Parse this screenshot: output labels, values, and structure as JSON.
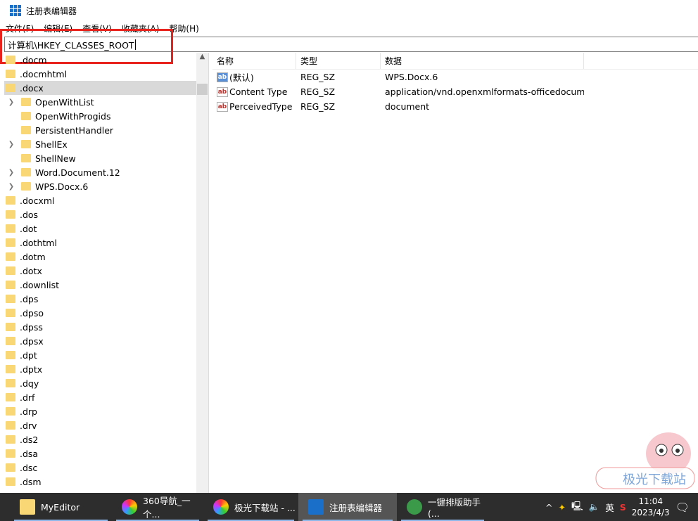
{
  "window": {
    "title": "注册表编辑器"
  },
  "menu": [
    "文件(F)",
    "编辑(E)",
    "查看(V)",
    "收藏夹(A)",
    "帮助(H)"
  ],
  "address": "计算机\\HKEY_CLASSES_ROOT",
  "tree": [
    {
      "label": ".docm",
      "level": 0
    },
    {
      "label": ".docmhtml",
      "level": 0
    },
    {
      "label": ".docx",
      "level": 0,
      "selected": true
    },
    {
      "label": "OpenWithList",
      "level": 1,
      "expandable": true
    },
    {
      "label": "OpenWithProgids",
      "level": 1
    },
    {
      "label": "PersistentHandler",
      "level": 1
    },
    {
      "label": "ShellEx",
      "level": 1,
      "expandable": true
    },
    {
      "label": "ShellNew",
      "level": 1
    },
    {
      "label": "Word.Document.12",
      "level": 1,
      "expandable": true
    },
    {
      "label": "WPS.Docx.6",
      "level": 1,
      "expandable": true
    },
    {
      "label": ".docxml",
      "level": 0
    },
    {
      "label": ".dos",
      "level": 0
    },
    {
      "label": ".dot",
      "level": 0
    },
    {
      "label": ".dothtml",
      "level": 0
    },
    {
      "label": ".dotm",
      "level": 0
    },
    {
      "label": ".dotx",
      "level": 0
    },
    {
      "label": ".downlist",
      "level": 0
    },
    {
      "label": ".dps",
      "level": 0
    },
    {
      "label": ".dpso",
      "level": 0
    },
    {
      "label": ".dpss",
      "level": 0
    },
    {
      "label": ".dpsx",
      "level": 0
    },
    {
      "label": ".dpt",
      "level": 0
    },
    {
      "label": ".dptx",
      "level": 0
    },
    {
      "label": ".dqy",
      "level": 0
    },
    {
      "label": ".drf",
      "level": 0
    },
    {
      "label": ".drp",
      "level": 0
    },
    {
      "label": ".drv",
      "level": 0
    },
    {
      "label": ".ds2",
      "level": 0
    },
    {
      "label": ".dsa",
      "level": 0
    },
    {
      "label": ".dsc",
      "level": 0
    },
    {
      "label": ".dsm",
      "level": 0
    }
  ],
  "list": {
    "headers": [
      "名称",
      "类型",
      "数据"
    ],
    "rows": [
      {
        "name": "(默认)",
        "type": "REG_SZ",
        "data": "WPS.Docx.6",
        "default": true
      },
      {
        "name": "Content Type",
        "type": "REG_SZ",
        "data": "application/vnd.openxmlformats-officedocum..."
      },
      {
        "name": "PerceivedType",
        "type": "REG_SZ",
        "data": "document"
      }
    ]
  },
  "taskbar": {
    "items": [
      {
        "label": "MyEditor",
        "icon": "folder-icon",
        "color": "#f8d774"
      },
      {
        "label": "360导航_一个...",
        "icon": "360-browser-icon",
        "color": "#e84"
      },
      {
        "label": "极光下载站 - ...",
        "icon": "360-browser-icon",
        "color": "#e84"
      },
      {
        "label": "注册表编辑器",
        "icon": "regedit-icon",
        "color": "#1a6fc9",
        "active": true
      },
      {
        "label": "一键排版助手(...",
        "icon": "paiban-icon",
        "color": "#3a9a4a"
      }
    ],
    "ime": "英",
    "time": "11:04",
    "date": "2023/4/3"
  },
  "colors": {
    "highlight": "#e8231e",
    "taskbar": "#2d2d2d"
  }
}
